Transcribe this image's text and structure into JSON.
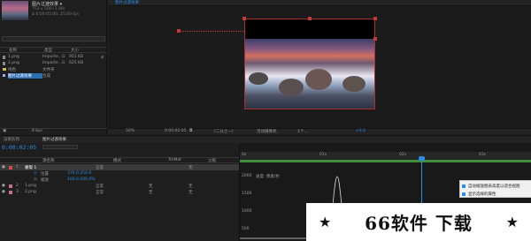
{
  "project": {
    "comp_name": "图片过渡效果 ▾",
    "comp_info": "752 x 500 (1.00)",
    "comp_time": "Δ 0:00:05:00, 25.00 fps",
    "search_placeholder": "",
    "columns": {
      "name": "名称",
      "type": "类型",
      "size": "大小"
    },
    "items": [
      {
        "name": "1.png",
        "type": "Importe...G",
        "size": "951 KB"
      },
      {
        "name": "2.png",
        "type": "Importe...G",
        "size": "625 KB"
      },
      {
        "name": "纯色",
        "type": "文件夹",
        "size": ""
      },
      {
        "name": "图片过渡效果",
        "type": "合成",
        "size": ""
      }
    ],
    "bpc": "8 bpc"
  },
  "comp_viewer": {
    "tab": "图片过渡效果",
    "toolbar": [
      "50%",
      "0:00:02:05",
      "(二分之一)",
      "活动摄像机",
      "1个...",
      "+0.0"
    ]
  },
  "timeline": {
    "tabs": [
      "渲染队列",
      "图片过渡效果"
    ],
    "current_time": "0:00:02:05",
    "columns": {
      "layer_name": "源名称",
      "mode": "模式",
      "trkmat": "TrkMat",
      "parent": "父级"
    },
    "layers": [
      {
        "index": "1",
        "name": "蒙版 1",
        "mode": "正常",
        "trkmat": "",
        "parent": "无",
        "selected": true
      },
      {
        "index": "",
        "name": "位置",
        "mode": "",
        "trkmat": "",
        "parent": "",
        "value": "376.0,250.0"
      },
      {
        "index": "",
        "name": "缩放",
        "mode": "",
        "trkmat": "",
        "parent": "",
        "value": "100.0,100.0%"
      },
      {
        "index": "2",
        "name": "1.png",
        "mode": "正常",
        "trkmat": "无",
        "parent": "无"
      },
      {
        "index": "3",
        "name": "2.png",
        "mode": "正常",
        "trkmat": "无",
        "parent": "无"
      }
    ],
    "ruler": [
      "0s",
      "01s",
      "02s",
      "03s",
      "04s"
    ],
    "graph_labels": [
      "2000",
      "1500",
      "1000",
      "500"
    ],
    "graph_value_label": "速度: 像素/秒",
    "context_menu": [
      "自动缩放图表高度以适合视图",
      "显示选择的属性"
    ]
  },
  "watermark": {
    "text": "66软件 下载",
    "stars": [
      "★",
      "★"
    ]
  }
}
